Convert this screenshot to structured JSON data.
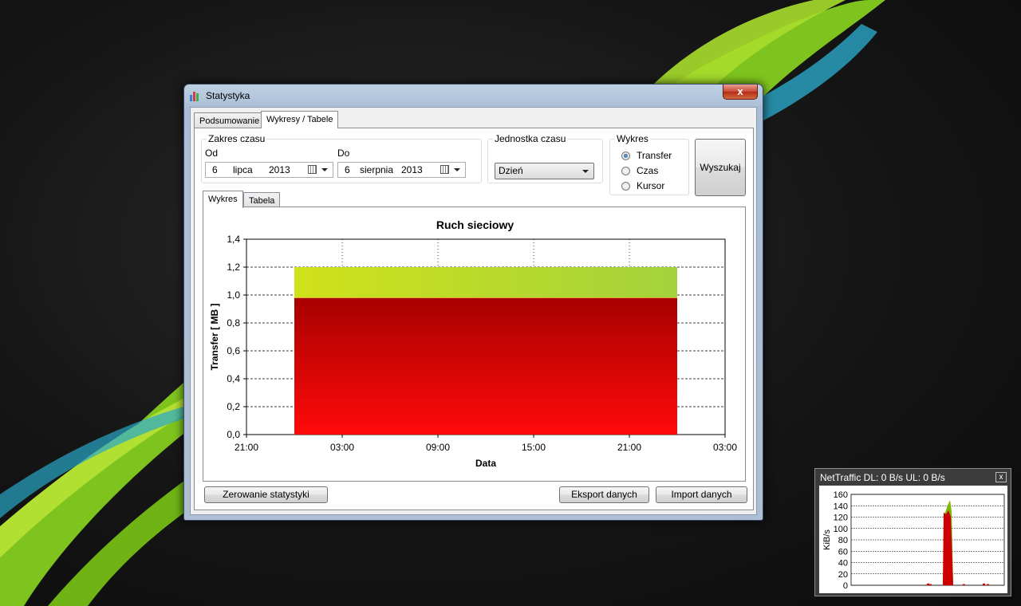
{
  "window": {
    "title": "Statystyka",
    "close_glyph": "x",
    "tabs": [
      {
        "label": "Podsumowanie",
        "active": false
      },
      {
        "label": "Wykresy / Tabele",
        "active": true
      }
    ]
  },
  "range": {
    "group_label": "Zakres czasu",
    "from_label": "Od",
    "from": {
      "day": "6",
      "month": "lipca",
      "year": "2013"
    },
    "to_label": "Do",
    "to": {
      "day": "6",
      "month": "sierpnia",
      "year": "2013"
    }
  },
  "unit": {
    "group_label": "Jednostka czasu",
    "selected": "Dzień"
  },
  "chart_type": {
    "group_label": "Wykres",
    "options": [
      {
        "label": "Transfer",
        "checked": true
      },
      {
        "label": "Czas",
        "checked": false
      },
      {
        "label": "Kursor",
        "checked": false
      }
    ]
  },
  "search_button": "Wyszukaj",
  "inner_tabs": [
    {
      "label": "Wykres",
      "active": true
    },
    {
      "label": "Tabela",
      "active": false
    }
  ],
  "buttons": {
    "reset": "Zerowanie statystyki",
    "export": "Eksport danych",
    "import": "Import danych"
  },
  "chart_data": {
    "type": "area",
    "title": "Ruch sieciowy",
    "xlabel": "Data",
    "ylabel": "Transfer [ MB ]",
    "ylim": [
      0,
      1.4
    ],
    "yticks": [
      "0,0",
      "0,2",
      "0,4",
      "0,6",
      "0,8",
      "1,0",
      "1,2",
      "1,4"
    ],
    "xticks": [
      "21:00",
      "03:00",
      "09:00",
      "15:00",
      "21:00",
      "03:00"
    ],
    "grid": true,
    "series": [
      {
        "color": "#d40000",
        "x": [
          "00:00",
          "00:00"
        ],
        "values": [
          0.98,
          0.98
        ]
      },
      {
        "color": "#b8d82a",
        "x": [
          "00:00",
          "00:00"
        ],
        "values": [
          1.2,
          1.2
        ]
      }
    ],
    "bar_span_hours": [
      3,
      27
    ]
  },
  "nettraffic": {
    "title": "NetTraffic DL: 0 B/s UL: 0 B/s",
    "close_glyph": "x",
    "ylabel": "KiB/s",
    "yticks": [
      "0",
      "20",
      "40",
      "60",
      "80",
      "100",
      "120",
      "140",
      "160"
    ],
    "ylim": [
      0,
      160
    ],
    "colors": {
      "download": "#cc0000",
      "upload": "#7ab800"
    }
  }
}
